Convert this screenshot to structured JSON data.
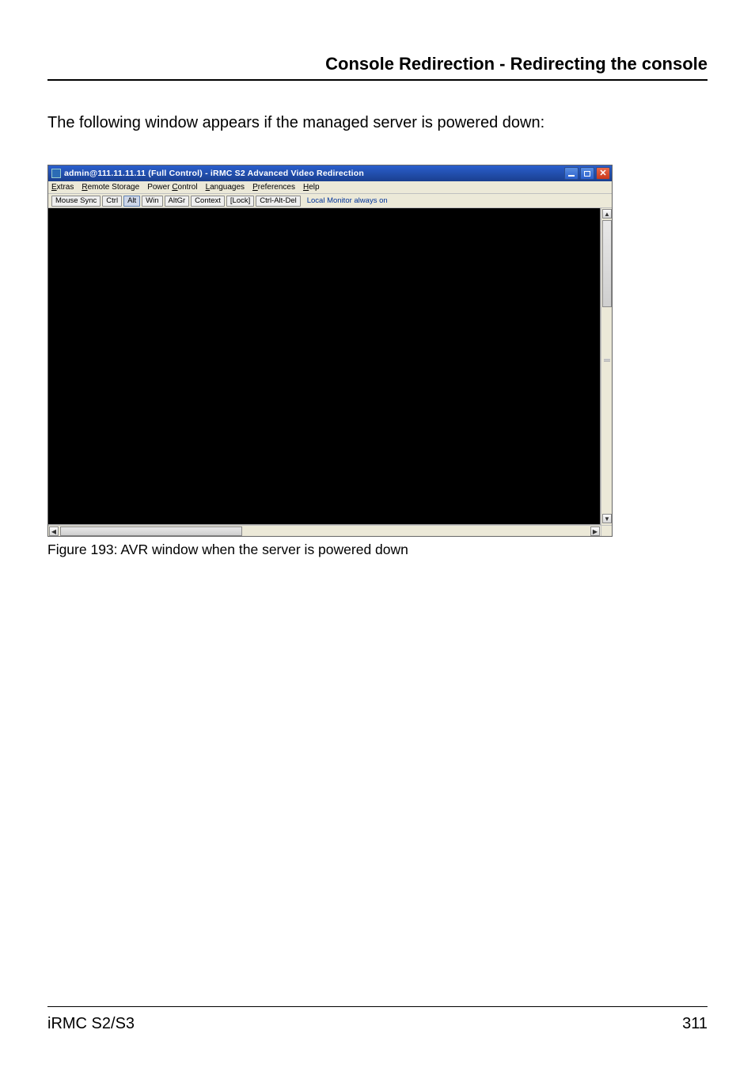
{
  "header": {
    "title": "Console Redirection - Redirecting the console"
  },
  "intro": "The following window appears if the managed server is powered down:",
  "window": {
    "title": "admin@111.11.11.11 (Full Control) - iRMC S2 Advanced Video Redirection",
    "titlebar_buttons": {
      "minimize_icon": "minimize-icon",
      "maximize_icon": "maximize-icon",
      "close_icon": "close-icon"
    },
    "menus": {
      "extras": {
        "pre": "",
        "u": "E",
        "post": "xtras"
      },
      "remote": {
        "pre": "",
        "u": "R",
        "post": "emote Storage"
      },
      "power": {
        "pre": "Power ",
        "u": "C",
        "post": "ontrol"
      },
      "lang": {
        "pre": "",
        "u": "L",
        "post": "anguages"
      },
      "pref": {
        "pre": "",
        "u": "P",
        "post": "references"
      },
      "help": {
        "pre": "",
        "u": "H",
        "post": "elp"
      }
    },
    "toolbar": {
      "mouse_sync": "Mouse Sync",
      "ctrl": "Ctrl",
      "alt": "Alt",
      "win": "Win",
      "altgr": "AltGr",
      "context": "Context",
      "lock": "[Lock]",
      "cad": "Ctrl-Alt-Del",
      "local_monitor": "Local Monitor always on"
    }
  },
  "caption": "Figure 193: AVR window when the server is powered down",
  "footer": {
    "left": "iRMC S2/S3",
    "right": "311"
  }
}
